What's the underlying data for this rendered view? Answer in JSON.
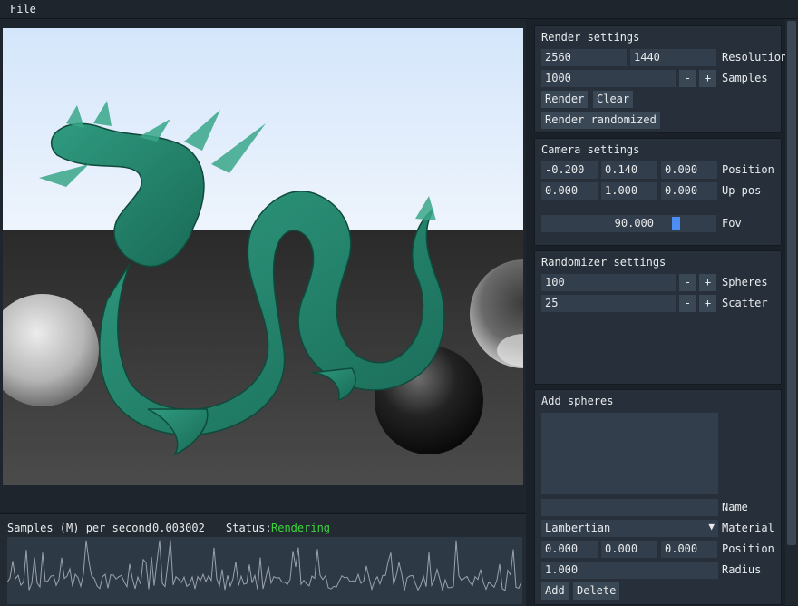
{
  "menu": {
    "file": "File"
  },
  "stats": {
    "samples_label": "Samples (M) per second",
    "samples_value": "0.003002",
    "status_label": "Status:",
    "status_value": "Rendering"
  },
  "render_settings": {
    "title": "Render settings",
    "res_w": "2560",
    "res_h": "1440",
    "resolution_label": "Resolution",
    "samples": "1000",
    "minus": "-",
    "plus": "+",
    "samples_label": "Samples",
    "render_btn": "Render",
    "clear_btn": "Clear",
    "render_randomized_btn": "Render randomized"
  },
  "camera_settings": {
    "title": "Camera settings",
    "pos": [
      "-0.200",
      "0.140",
      "0.000"
    ],
    "position_label": "Position",
    "up": [
      "0.000",
      "1.000",
      "0.000"
    ],
    "up_label": "Up pos",
    "fov": "90.000",
    "fov_label": "Fov",
    "fov_fraction": 0.78
  },
  "randomizer_settings": {
    "title": "Randomizer settings",
    "spheres": "100",
    "spheres_label": "Spheres",
    "scatter": "25",
    "scatter_label": "Scatter",
    "minus": "-",
    "plus": "+"
  },
  "add_spheres": {
    "title": "Add spheres",
    "name_value": "",
    "name_label": "Name",
    "material": "Lambertian",
    "material_label": "Material",
    "pos": [
      "0.000",
      "0.000",
      "0.000"
    ],
    "position_label": "Position",
    "radius": "1.000",
    "radius_label": "Radius",
    "add_btn": "Add",
    "delete_btn": "Delete"
  },
  "colors": {
    "accent": "#4c8ef5",
    "status": "#3cd43c",
    "panel": "#27303a",
    "field": "#323e4b"
  },
  "icons": {
    "dropdown": "triangle-down-icon"
  }
}
